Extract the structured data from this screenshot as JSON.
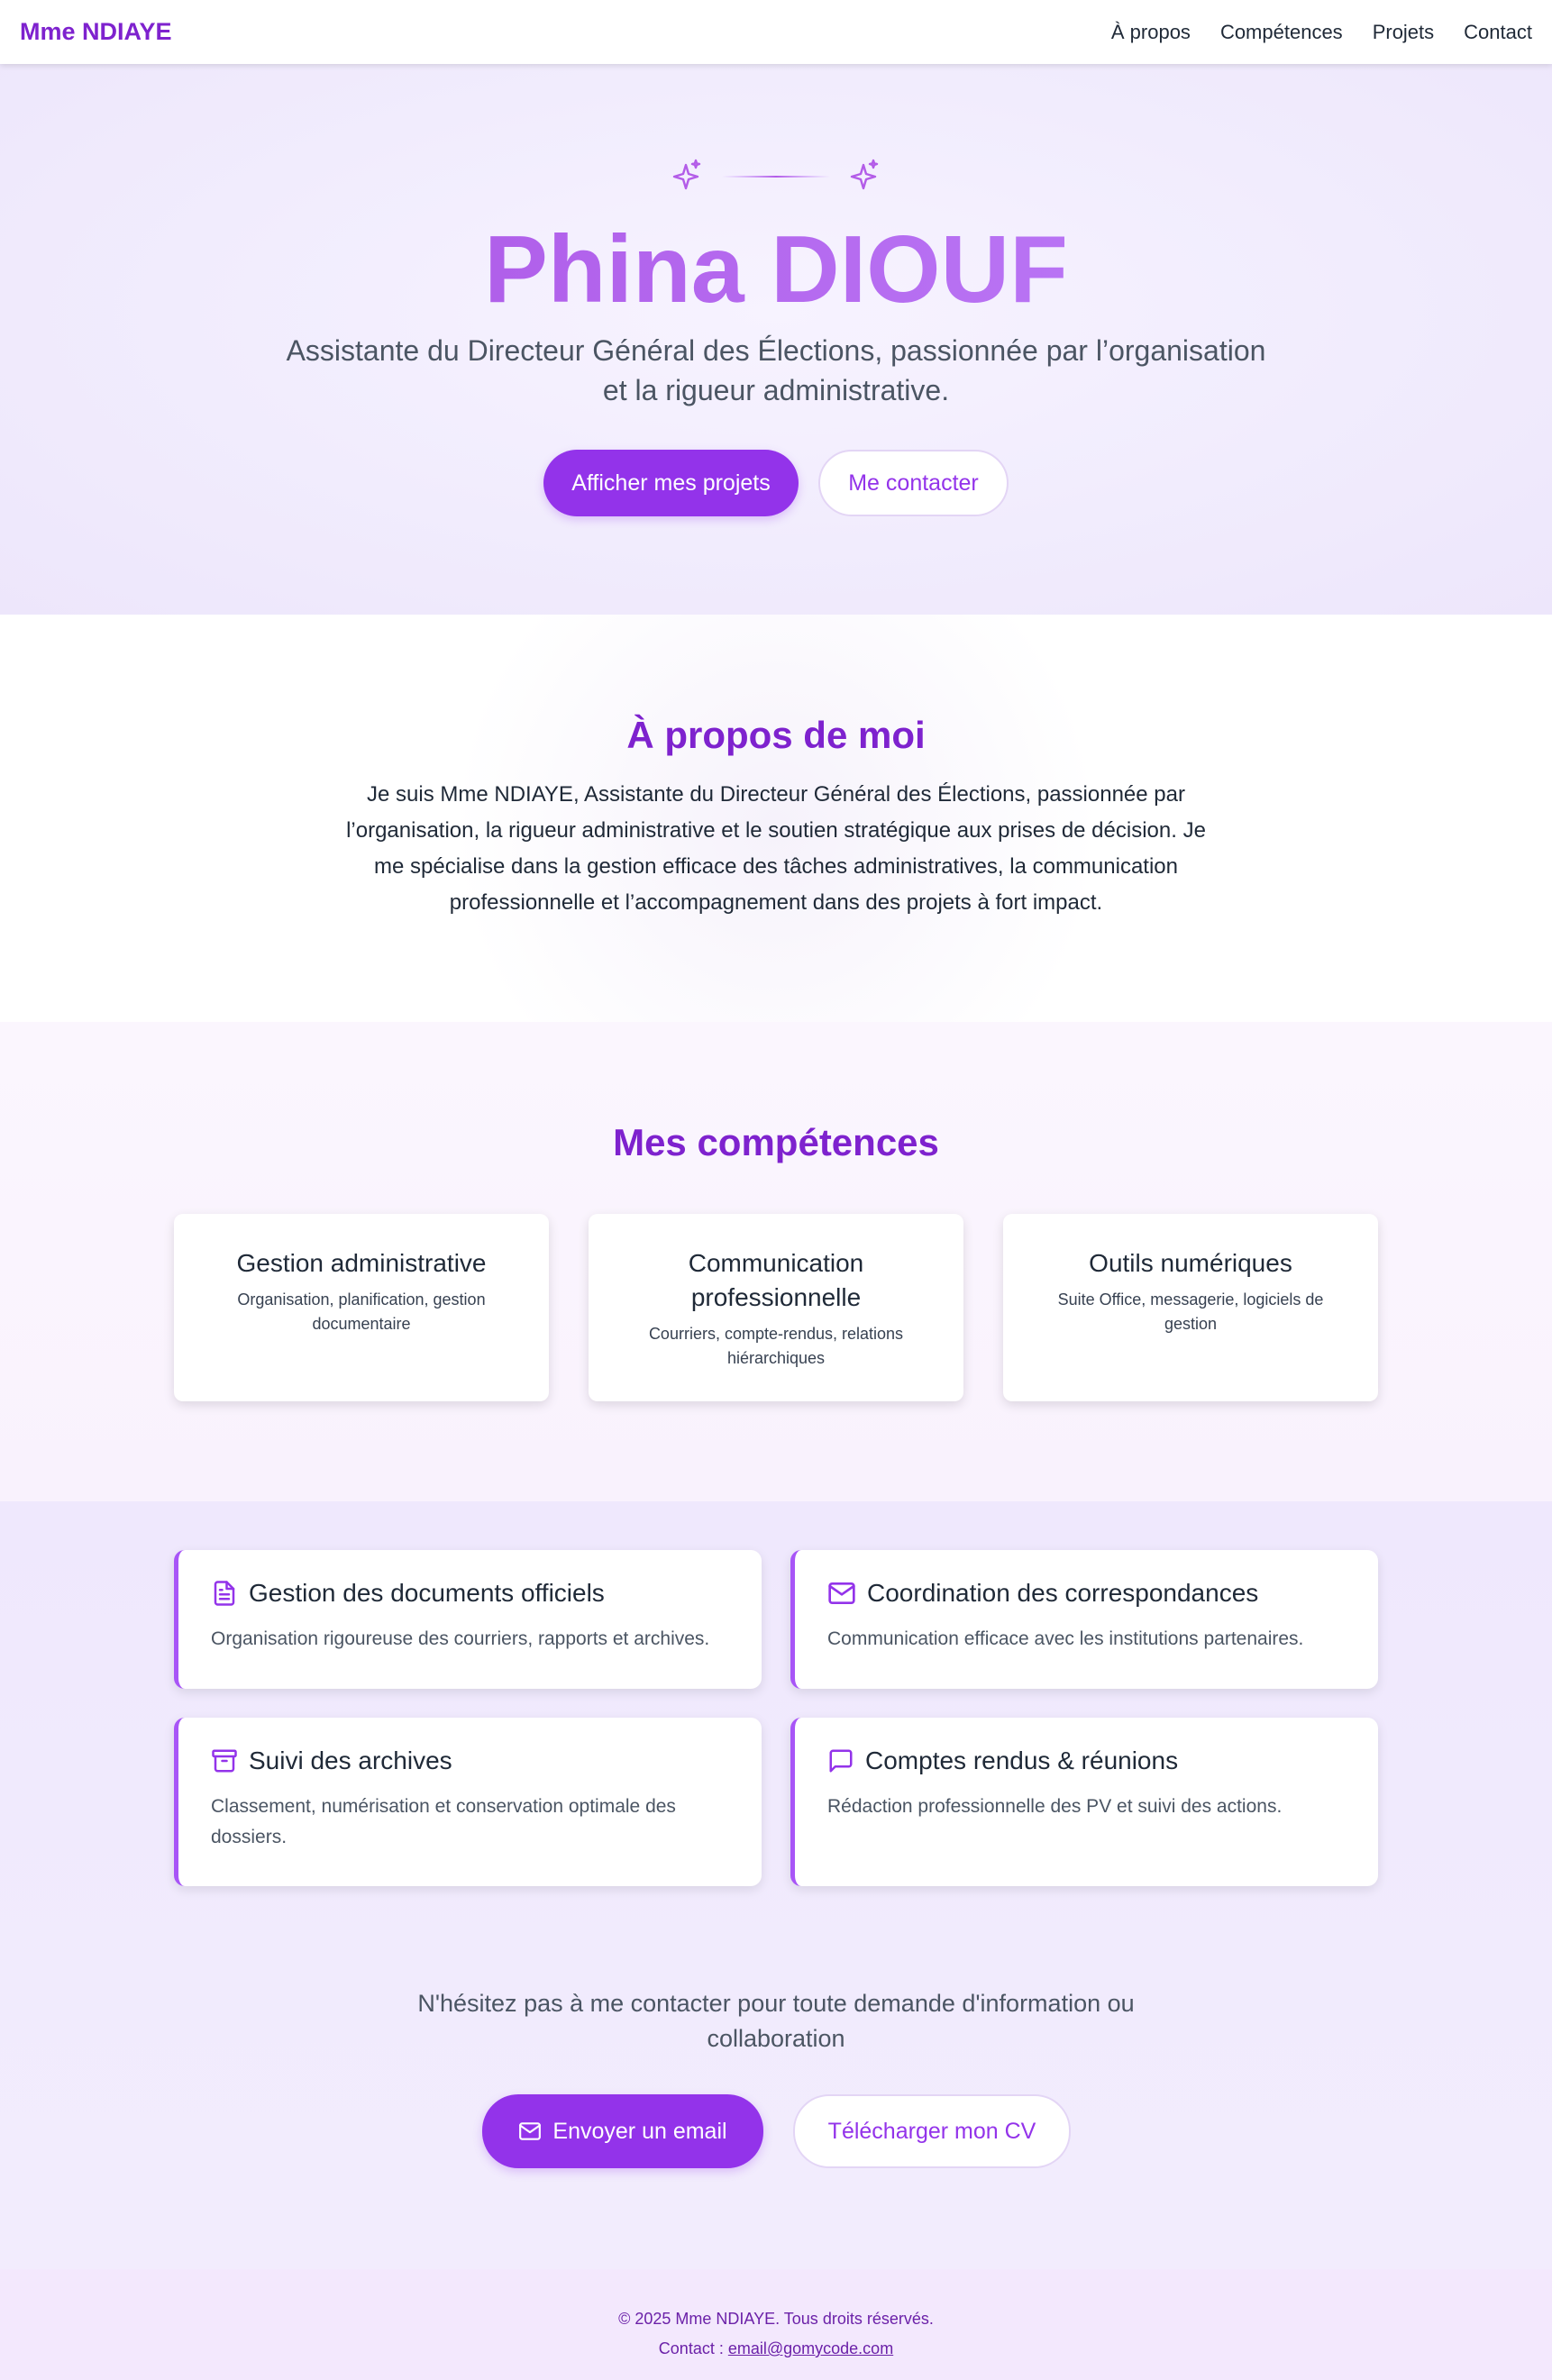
{
  "nav": {
    "brand": "Mme NDIAYE",
    "links": [
      "À propos",
      "Compétences",
      "Projets",
      "Contact"
    ]
  },
  "hero": {
    "title": "Phina DIOUF",
    "subtitle": "Assistante du Directeur Général des Élections, passionnée par l’organisation et la rigueur administrative.",
    "primary_button": "Afficher mes projets",
    "secondary_button": "Me contacter",
    "sparkle_icon": "sparkles-icon"
  },
  "about": {
    "title": "À propos de moi",
    "text": "Je suis Mme NDIAYE, Assistante du Directeur Général des Élections, passionnée par l’organisation, la rigueur administrative et le soutien stratégique aux prises de décision. Je me spécialise dans la gestion efficace des tâches administratives, la communication professionnelle et l’accompagnement dans des projets à fort impact."
  },
  "skills": {
    "title": "Mes compétences",
    "items": [
      {
        "title": "Gestion administrative",
        "desc": "Organisation, planification, gestion documentaire"
      },
      {
        "title": "Communication professionnelle",
        "desc": "Courriers, compte-rendus, relations hiérarchiques"
      },
      {
        "title": "Outils numériques",
        "desc": "Suite Office, messagerie, logiciels de gestion"
      }
    ]
  },
  "projects": {
    "items": [
      {
        "icon": "file-text-icon",
        "title": "Gestion des documents officiels",
        "desc": "Organisation rigoureuse des courriers, rapports et archives."
      },
      {
        "icon": "mail-icon",
        "title": "Coordination des correspondances",
        "desc": "Communication efficace avec les institutions partenaires."
      },
      {
        "icon": "archive-icon",
        "title": "Suivi des archives",
        "desc": "Classement, numérisation et conservation optimale des dossiers."
      },
      {
        "icon": "message-icon",
        "title": "Comptes rendus & réunions",
        "desc": "Rédaction professionnelle des PV et suivi des actions."
      }
    ]
  },
  "contact": {
    "text": "N'hésitez pas à me contacter pour toute demande d'information ou collaboration",
    "email_button": "Envoyer un email",
    "cv_button": "Télécharger mon CV"
  },
  "footer": {
    "copyright": "© 2025 Mme NDIAYE. Tous droits réservés.",
    "contact_label": "Contact : ",
    "email": "email@gomycode.com"
  },
  "colors": {
    "accent": "#9333ea",
    "heading": "#7e22ce",
    "hero_gradient_start": "#a94fe2",
    "hero_gradient_end": "#c084fc",
    "footer_bg": "#f3e8fd"
  }
}
